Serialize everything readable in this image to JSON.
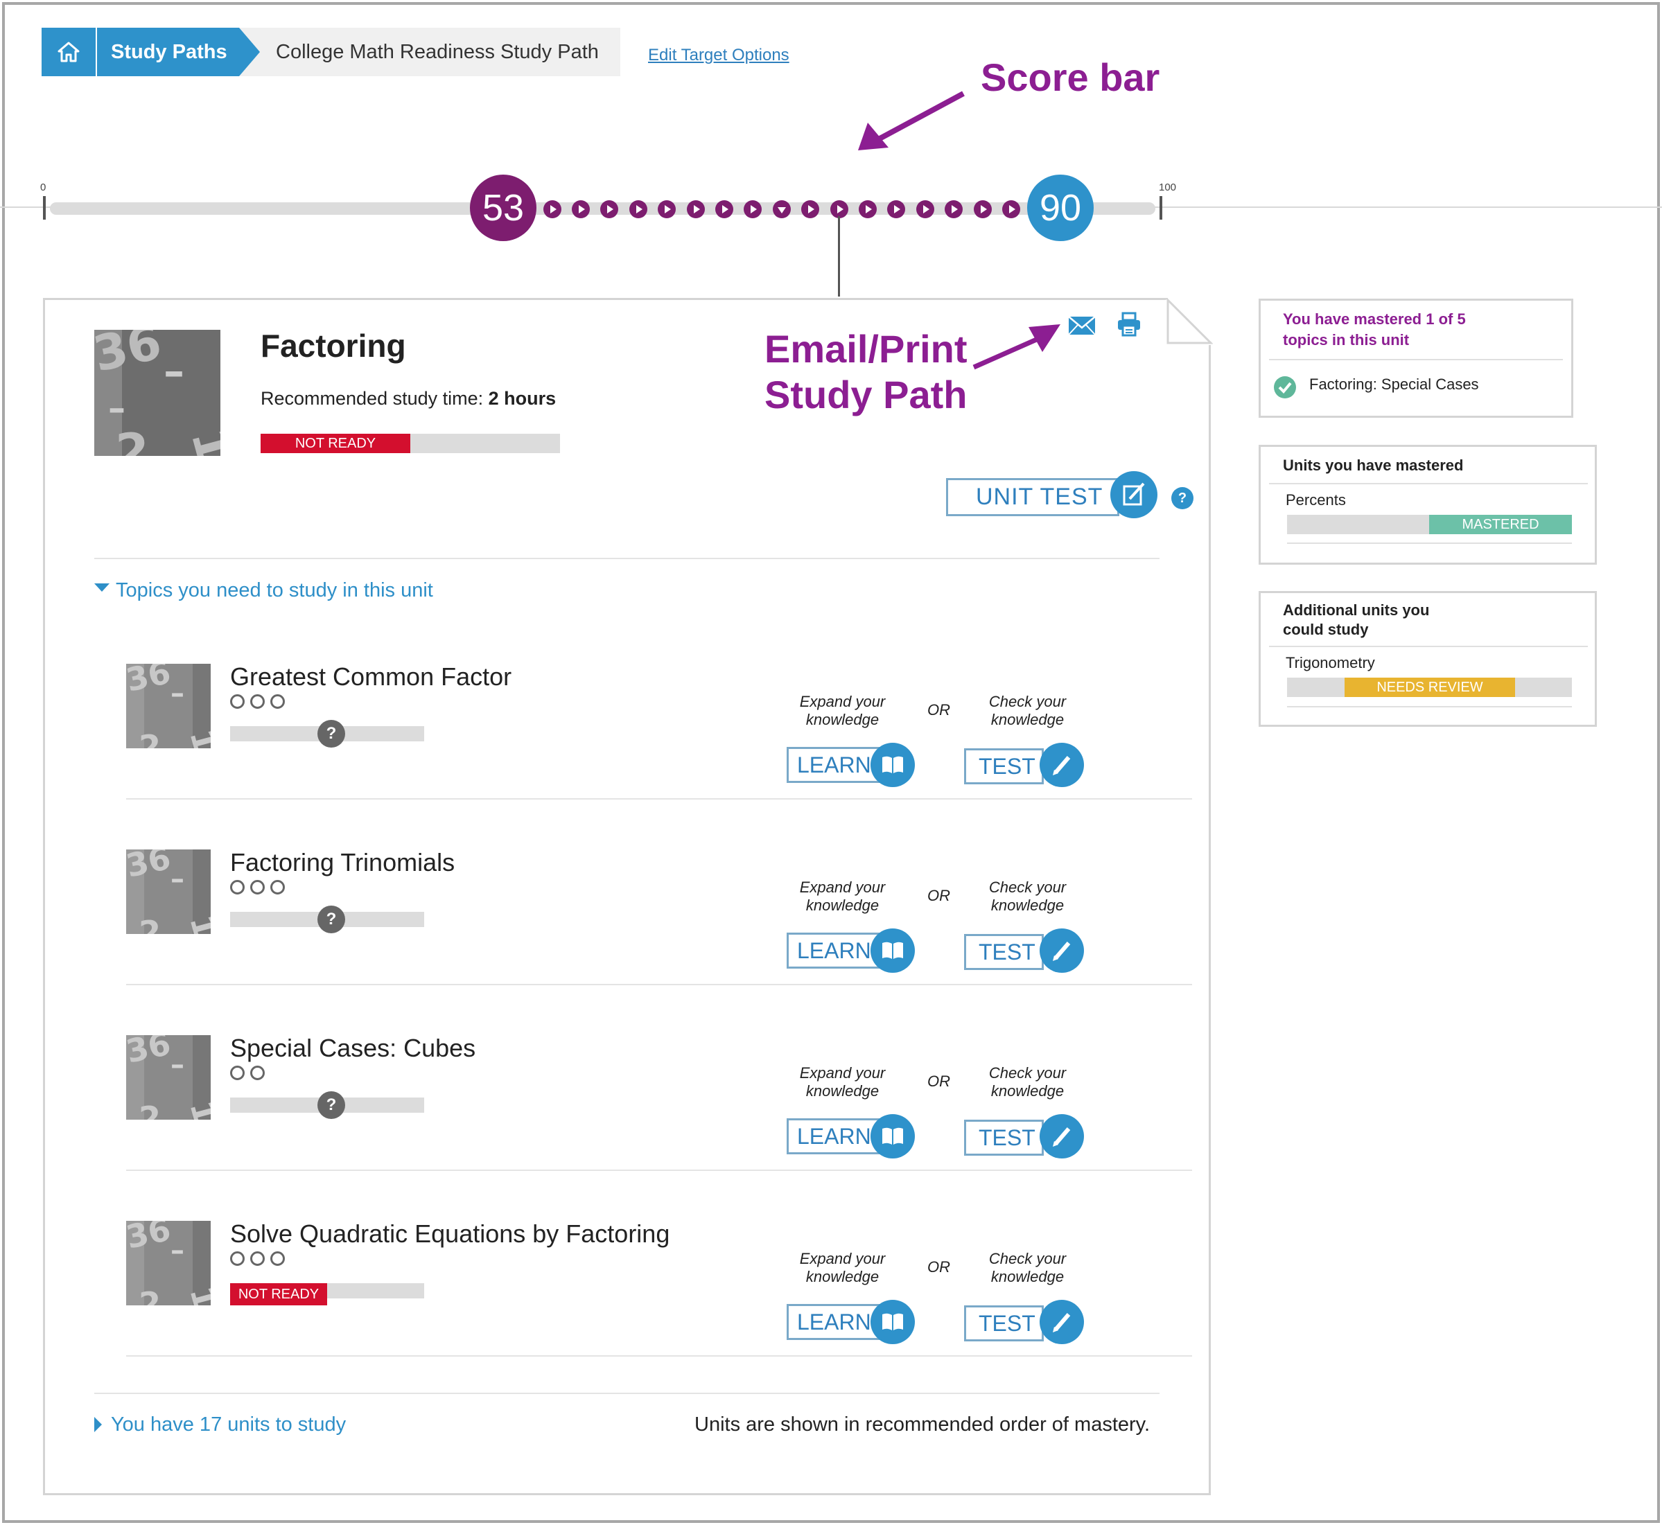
{
  "breadcrumb": {
    "home_icon": "home-icon",
    "study_paths": "Study Paths",
    "current": "College Math Readiness Study Path",
    "edit_link": "Edit Target Options"
  },
  "annotations": {
    "score_bar": "Score bar",
    "email_print_line1": "Email/Print",
    "email_print_line2": "Study Path"
  },
  "score_bar": {
    "min_label": "0",
    "max_label": "100",
    "current_score": "53",
    "target_score": "90",
    "current_value": 53,
    "target_value": 90,
    "current_color": "#7d1d6f",
    "target_color": "#2e92cb"
  },
  "unit": {
    "name": "Factoring",
    "rec_label": "Recommended study time: ",
    "rec_value": "2 hours",
    "status": "NOT READY",
    "unit_test_label": "UNIT TEST",
    "help": "?",
    "email_icon": "envelope-icon",
    "print_icon": "printer-icon"
  },
  "topics_header": "Topics you need to study in this unit",
  "topics": [
    {
      "name": "Greatest Common Factor",
      "circles": 3,
      "status": "?"
    },
    {
      "name": "Factoring Trinomials",
      "circles": 3,
      "status": "?"
    },
    {
      "name": "Special Cases: Cubes",
      "circles": 2,
      "status": "?"
    },
    {
      "name": "Solve Quadratic Equations by Factoring",
      "circles": 3,
      "status": "NOT READY"
    }
  ],
  "topic_actions": {
    "expand_1": "Expand your",
    "expand_2": "knowledge",
    "or": "OR",
    "check_1": "Check your",
    "check_2": "knowledge",
    "learn": "LEARN",
    "test": "TEST"
  },
  "footer": {
    "units_left": "You have 17 units to study",
    "order_note": "Units are shown in recommended order of mastery."
  },
  "sidebar": {
    "mastered_topics": {
      "title_1": "You have mastered 1 of 5",
      "title_2": "topics in this unit",
      "item": "Factoring: Special Cases",
      "item_icon": "check-circle-icon"
    },
    "mastered_units": {
      "title": "Units you have mastered",
      "item": "Percents",
      "badge": "MASTERED",
      "badge_color": "#6cc1a8"
    },
    "additional_units": {
      "title_1": "Additional units you",
      "title_2": "could study",
      "item": "Trigonometry",
      "badge": "NEEDS REVIEW",
      "badge_color": "#e8b430"
    }
  }
}
